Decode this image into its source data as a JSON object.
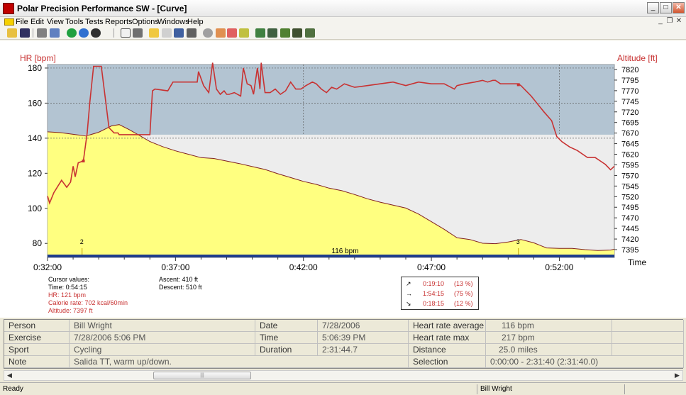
{
  "window": {
    "title": "Polar Precision Performance SW - [Curve]"
  },
  "menu": {
    "items": [
      "File",
      "Edit",
      "View",
      "Tools",
      "Tests",
      "Reports",
      "Options",
      "Windows",
      "Help"
    ]
  },
  "toolbar": {
    "icons": [
      "open-icon",
      "save-icon",
      "print-icon",
      "copy-icon",
      "refresh-icon",
      "globe-icon",
      "contrast-icon",
      "calendar-icon",
      "window-icon",
      "area-chart-icon",
      "bar-chart-icon",
      "export-icon",
      "column-icon",
      "zoom-icon",
      "chart-pencil-icon",
      "shape-icon",
      "chart-check-icon",
      "summary-1-icon",
      "summary-2-icon",
      "summary-3-icon",
      "summary-4-icon",
      "summary-5-icon"
    ]
  },
  "colors": {
    "hr_line": "#c83232",
    "altitude_fill": "#ffff80",
    "upper_zone": "#9fb6c8",
    "inner_bg": "#ededed",
    "axis_bar": "#1e3c8c"
  },
  "chart_data": {
    "type": "line",
    "xlabel": "Time",
    "left_axis": {
      "label": "HR [bpm]",
      "ticks": [
        80,
        100,
        120,
        140,
        160,
        180
      ],
      "range": [
        72,
        182
      ]
    },
    "right_axis": {
      "label": "Altitude [ft]",
      "ticks": [
        7395,
        7420,
        7445,
        7470,
        7495,
        7520,
        7545,
        7570,
        7595,
        7620,
        7645,
        7670,
        7695,
        7720,
        7745,
        7770,
        7795,
        7820
      ]
    },
    "x_ticks": [
      "0:32:00",
      "0:37:00",
      "0:42:00",
      "0:47:00",
      "0:52:00"
    ],
    "x_range_minutes": [
      32,
      54.15
    ],
    "bar_label": "116 bpm",
    "markers": [
      {
        "label": "2",
        "minute": 33.35
      },
      {
        "label": "3",
        "minute": 50.4
      }
    ],
    "series": [
      {
        "name": "HR",
        "x": [
          32.0,
          32.08,
          32.25,
          32.55,
          32.75,
          32.9,
          33.0,
          33.08,
          33.2,
          33.4,
          33.55,
          33.65,
          33.8,
          34.1,
          34.4,
          34.6,
          34.75,
          34.8,
          35.3,
          35.6,
          36.0,
          36.1,
          36.2,
          36.7,
          36.9,
          37.0,
          37.3,
          37.6,
          37.85,
          37.9,
          38.1,
          38.3,
          38.45,
          38.6,
          38.75,
          38.9,
          39.0,
          39.1,
          39.3,
          39.55,
          39.65,
          39.72,
          39.8,
          39.95,
          40.05,
          40.2,
          40.25,
          40.3,
          40.35,
          40.5,
          40.7,
          40.9,
          41.1,
          41.3,
          41.5,
          41.7,
          41.9,
          42.1,
          42.35,
          42.5,
          42.7,
          42.9,
          43.1,
          43.3,
          43.6,
          44.0,
          44.5,
          45.0,
          45.5,
          46.0,
          46.5,
          47.0,
          47.5,
          47.9,
          48.0,
          48.3,
          48.7,
          49.0,
          49.2,
          49.4,
          49.5,
          49.7,
          50.0,
          50.4,
          50.5,
          50.9,
          51.4,
          51.7,
          51.9,
          52.1,
          52.4,
          52.7,
          53.1,
          53.4,
          53.6,
          53.8,
          54.0,
          54.15
        ],
        "values": [
          107,
          103,
          109,
          116,
          112,
          115,
          124,
          118,
          126,
          127,
          143,
          160,
          181,
          181,
          146,
          143,
          143,
          142,
          142,
          142,
          142,
          167,
          168,
          167,
          172,
          172,
          172,
          172,
          172,
          178,
          170,
          166,
          183,
          168,
          165,
          167,
          165,
          165,
          166,
          164,
          180,
          176,
          171,
          170,
          165,
          180,
          175,
          168,
          183,
          166,
          166,
          168,
          165,
          167,
          172,
          168,
          168,
          170,
          172,
          171,
          168,
          166,
          169,
          168,
          171,
          169,
          170,
          171,
          172,
          170,
          172,
          171,
          171,
          168,
          170,
          171,
          172,
          173,
          172,
          173,
          173,
          171,
          171,
          171,
          170,
          164,
          155,
          150,
          141,
          138,
          135,
          133,
          129,
          129,
          127,
          125,
          122,
          124
        ]
      },
      {
        "name": "Altitude",
        "x": [
          32.0,
          32.5,
          33.0,
          33.5,
          34.0,
          34.5,
          34.8,
          35.2,
          35.6,
          36.0,
          36.5,
          37.0,
          37.5,
          38.0,
          38.5,
          39.0,
          39.5,
          40.0,
          40.5,
          41.0,
          41.5,
          42.0,
          42.5,
          43.0,
          43.5,
          44.0,
          44.5,
          45.0,
          45.5,
          46.0,
          46.5,
          47.0,
          47.5,
          48.0,
          48.5,
          49.0,
          49.5,
          50.0,
          50.5,
          51.0,
          51.5,
          52.0,
          52.5,
          53.0,
          53.5,
          54.0,
          54.15
        ],
        "values": [
          7673,
          7671,
          7667,
          7663,
          7672,
          7687,
          7690,
          7678,
          7664,
          7650,
          7638,
          7628,
          7620,
          7612,
          7610,
          7604,
          7598,
          7591,
          7584,
          7574,
          7565,
          7556,
          7549,
          7540,
          7534,
          7525,
          7515,
          7507,
          7500,
          7493,
          7479,
          7461,
          7443,
          7423,
          7419,
          7410,
          7409,
          7413,
          7419,
          7411,
          7399,
          7398,
          7398,
          7395,
          7393,
          7394,
          7396
        ]
      }
    ]
  },
  "cursor": {
    "heading": "Cursor values:",
    "time": "Time: 0:54:15",
    "hr": "HR: 121 bpm",
    "calorie": "Calorie rate: 702 kcal/60min",
    "altitude": "Altitude: 7397 ft",
    "ascent": "Ascent: 410 ft",
    "descent": "Descent: 510 ft"
  },
  "zones": [
    {
      "arrow": "↗",
      "time": "0:19:10",
      "pct": "(13 %)"
    },
    {
      "arrow": "→",
      "time": "1:54:15",
      "pct": "(75 %)"
    },
    {
      "arrow": "↘",
      "time": "0:18:15",
      "pct": "(12 %)"
    }
  ],
  "info": {
    "person_label": "Person",
    "person": "Bill Wright",
    "exercise_label": "Exercise",
    "exercise": "7/28/2006 5:06 PM",
    "sport_label": "Sport",
    "sport": "Cycling",
    "note_label": "Note",
    "note": "Salida TT, warm up/down.",
    "date_label": "Date",
    "date": "7/28/2006",
    "time_label": "Time",
    "time": "5:06:39 PM",
    "duration_label": "Duration",
    "duration": "2:31:44.7",
    "hr_avg_label": "Heart rate average",
    "hr_avg": "116 bpm",
    "hr_max_label": "Heart rate max",
    "hr_max": "217 bpm",
    "distance_label": "Distance",
    "distance": "25.0 miles",
    "selection_label": "Selection",
    "selection": "0:00:00 - 2:31:40 (2:31:40.0)"
  },
  "status": {
    "left": "Ready",
    "right": "Bill Wright"
  }
}
